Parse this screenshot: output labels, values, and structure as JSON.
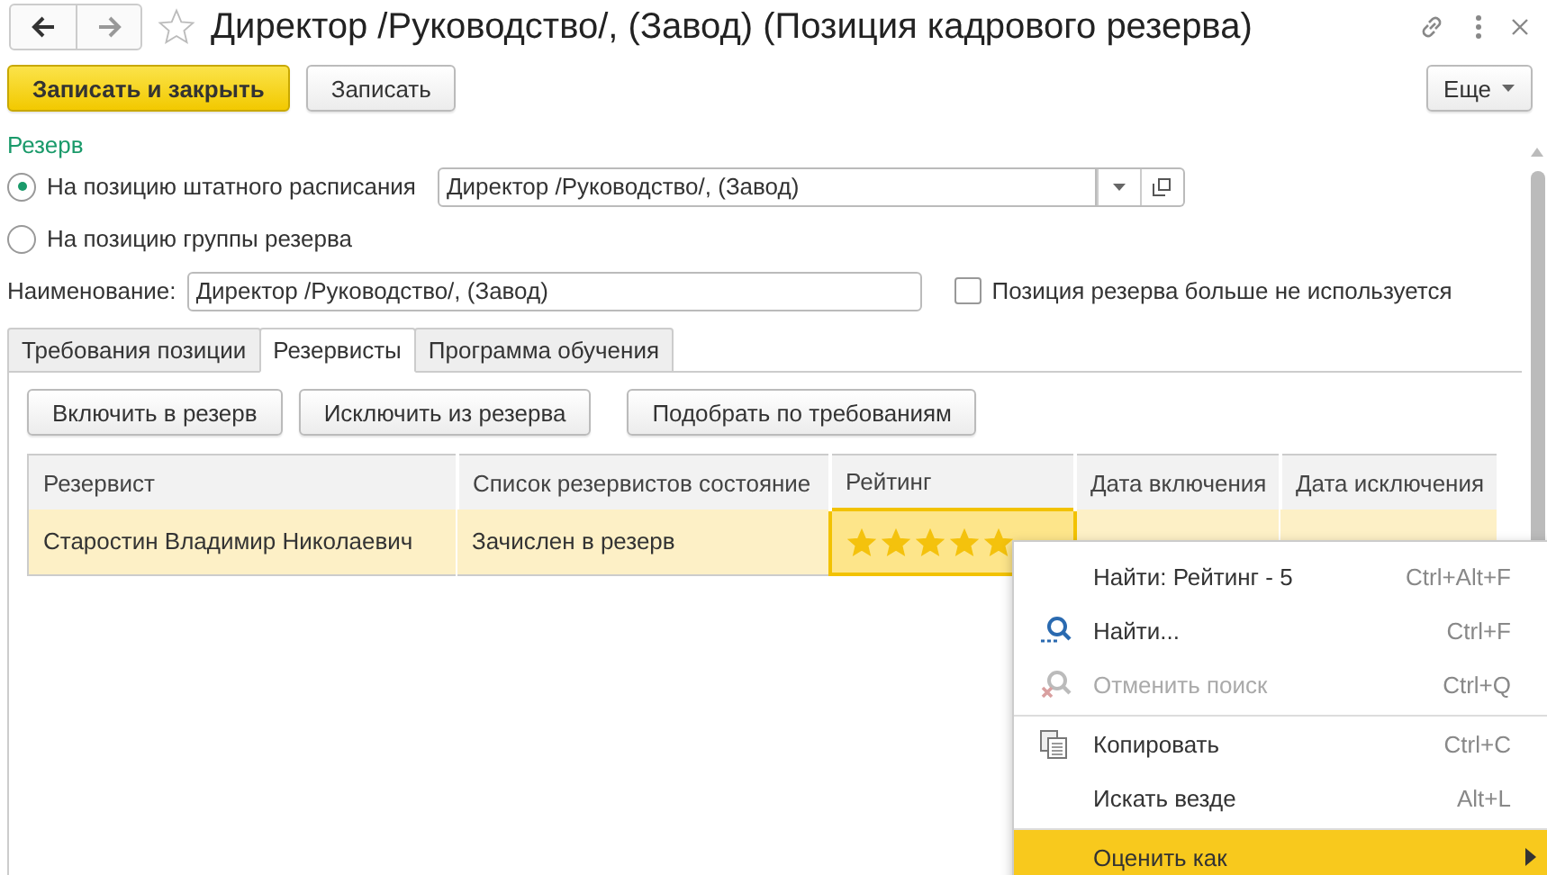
{
  "window": {
    "title": "Директор /Руководство/, (Завод) (Позиция кадрового резерва)",
    "favorite": false
  },
  "toolbar": {
    "buttons": [
      {
        "label": "Записать и закрыть",
        "kind": "primary"
      },
      {
        "label": "Записать",
        "kind": "default"
      }
    ],
    "more": "Еще"
  },
  "section_title": "Резерв",
  "radios": [
    {
      "label": "На позицию штатного расписания",
      "selected": true,
      "value": "Директор /Руководство/, (Завод)"
    },
    {
      "label": "На позицию группы резерва",
      "selected": false
    }
  ],
  "name_field": {
    "label": "Наименование:",
    "value": "Директор /Руководство/, (Завод)"
  },
  "unused_checkbox": {
    "label": "Позиция резерва больше не используется",
    "checked": false
  },
  "tabs": [
    {
      "label": "Требования позиции",
      "selected": false
    },
    {
      "label": "Резервисты",
      "selected": true
    },
    {
      "label": "Программа обучения",
      "selected": false
    }
  ],
  "panel_buttons": [
    "Включить в резерв",
    "Исключить из резерва",
    "Подобрать по требованиям"
  ],
  "table": {
    "columns": [
      "Резервист",
      "Список резервистов состояние",
      "Рейтинг",
      "Дата включения",
      "Дата исключения"
    ],
    "rows": [
      {
        "name": "Старостин Владимир Николаевич",
        "state": "Зачислен в резерв",
        "stars": 5,
        "selected": true
      }
    ]
  },
  "context_menu": [
    {
      "label": "Найти: Рейтинг - 5",
      "shortcut": "Ctrl+Alt+F",
      "kind": "plain",
      "disabled": false,
      "selected": false,
      "separator_before": false,
      "has_submenu": false
    },
    {
      "label": "Найти...",
      "shortcut": "Ctrl+F",
      "kind": "search",
      "disabled": false,
      "selected": false,
      "separator_before": false,
      "has_submenu": false
    },
    {
      "label": "Отменить поиск",
      "shortcut": "Ctrl+Q",
      "kind": "cancel-search",
      "disabled": true,
      "selected": false,
      "separator_before": false,
      "has_submenu": false
    },
    {
      "label": "Копировать",
      "shortcut": "Ctrl+C",
      "kind": "copy",
      "disabled": false,
      "selected": false,
      "separator_before": true,
      "has_submenu": false
    },
    {
      "label": "Искать везде",
      "shortcut": "Alt+L",
      "kind": "plain",
      "disabled": false,
      "selected": false,
      "separator_before": false,
      "has_submenu": false
    },
    {
      "label": "Оценить как",
      "kind": "plain",
      "disabled": false,
      "selected": true,
      "separator_before": true,
      "has_submenu": true
    }
  ]
}
